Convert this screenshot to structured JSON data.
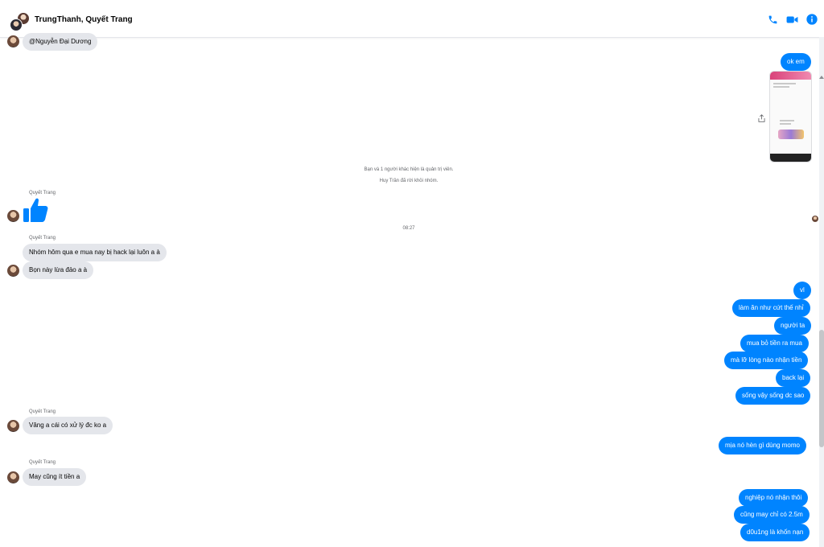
{
  "header": {
    "title": "TrungThanh, Quyết Trang",
    "icons": [
      "phone-icon",
      "video-camera-icon",
      "info-icon"
    ],
    "accent_color": "#0084ff"
  },
  "messages": {
    "m_mention": "@Nguyễn Đại Dương",
    "m_ok": "ok em",
    "sys1": "Bạn và 1 người khác hiện là quản trị viên.",
    "sys2": "Huy Trần đã rời khỏi nhóm.",
    "sender": "Quyết Trang",
    "time": "08:27",
    "in1": "Nhóm hôm qua e mua nay bị hack lại luôn a à",
    "in2": "Bọn này lừa đảo a à",
    "out1": "vl",
    "out2": "làm ăn như cứt thế nhỉ",
    "out3": "người ta",
    "out4": "mua bỏ tiền ra mua",
    "out5": "mà lỡ lòng nào nhận tiền",
    "out6": "back lại",
    "out7": "sống vậy sống dc sao",
    "in3": "Vâng a cái có xử lý đc ko a",
    "out8": "mịa nó hèn gì dùng momo",
    "in4": "May cũng ít tiền a",
    "out9": "nghiệp nó nhận thôi",
    "out10": "cũng may chỉ có 2.5m",
    "out11": "d0u1ng là khốn nạn"
  },
  "colors": {
    "outgoing": "#0084ff",
    "incoming": "#e4e6eb"
  }
}
